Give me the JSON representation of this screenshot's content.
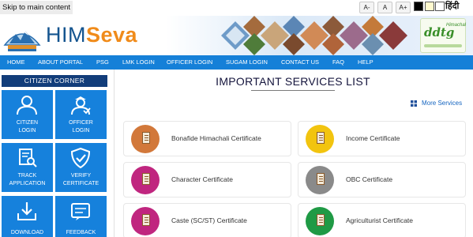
{
  "accessibility": {
    "skip_link": "Skip to main content",
    "font_small": "A-",
    "font_normal": "A",
    "font_large": "A+",
    "language": "हिंदी"
  },
  "header": {
    "brand_part1": "HIM",
    "brand_part2": "Seva",
    "partner_logo_text": "ddtg",
    "partner_logo_sub": "Himachal"
  },
  "nav": {
    "items": [
      "HOME",
      "ABOUT PORTAL",
      "PSG",
      "LMK LOGIN",
      "OFFICER LOGIN",
      "SUGAM LOGIN",
      "CONTACT US",
      "FAQ",
      "HELP"
    ]
  },
  "sidebar": {
    "title": "CITIZEN CORNER",
    "tiles": [
      {
        "line1": "CITIZEN",
        "line2": "LOGIN"
      },
      {
        "line1": "OFFICER",
        "line2": "LOGIN"
      },
      {
        "line1": "TRACK",
        "line2": "APPLICATION"
      },
      {
        "line1": "VERIFY",
        "line2": "CERTIFICATE"
      },
      {
        "line1": "DOWNLOAD",
        "line2": ""
      },
      {
        "line1": "FEEDBACK",
        "line2": ""
      }
    ]
  },
  "main": {
    "title": "IMPORTANT SERVICES LIST",
    "more_services": "More Services",
    "services": [
      {
        "label": "Bonafide Himachali Certificate",
        "color": "#d2783a"
      },
      {
        "label": "Income Certificate",
        "color": "#f2c40f"
      },
      {
        "label": "Character Certificate",
        "color": "#c0267f"
      },
      {
        "label": "OBC Certificate",
        "color": "#8a8a8a"
      },
      {
        "label": "Caste (SC/ST) Certificate",
        "color": "#c0267f"
      },
      {
        "label": "Agriculturist Certificate",
        "color": "#1f9a45"
      }
    ]
  },
  "colors": {
    "nav_bg": "#1580d8",
    "tile_bg": "#1681dc",
    "sidebar_header_bg": "#123d7a",
    "brand_blue": "#14548f",
    "brand_orange": "#f08b1a"
  }
}
